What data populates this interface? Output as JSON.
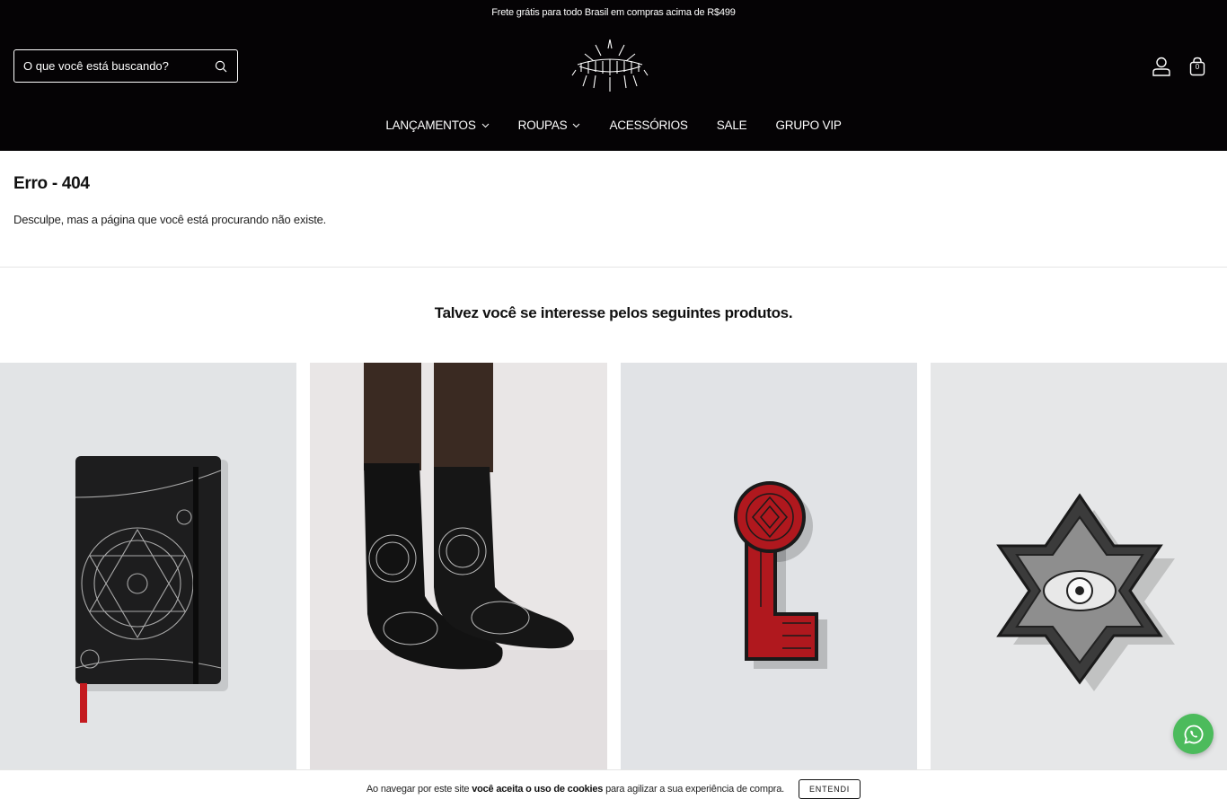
{
  "topbar": {
    "text": "Frete grátis para todo Brasil em compras acima de R$499"
  },
  "search": {
    "placeholder": "O que você está buscando?"
  },
  "header": {
    "cart_count": "0"
  },
  "nav": {
    "items": [
      {
        "label": "LANÇAMENTOS",
        "has_dropdown": true
      },
      {
        "label": "ROUPAS",
        "has_dropdown": true
      },
      {
        "label": "ACESSÓRIOS",
        "has_dropdown": false
      },
      {
        "label": "SALE",
        "has_dropdown": false
      },
      {
        "label": "GRUPO VIP",
        "has_dropdown": false
      }
    ]
  },
  "error": {
    "title": "Erro - 404",
    "message": "Desculpe, mas a página que você está procurando não existe."
  },
  "suggestions": {
    "title": "Talvez você se interesse pelos seguintes produtos."
  },
  "cookie": {
    "text_before": "Ao navegar por este site ",
    "text_bold": "você aceita o uso de cookies",
    "text_after": " para agilizar a sua experiência de compra.",
    "button": "ENTENDI"
  },
  "colors": {
    "header_bg": "#050305",
    "whatsapp": "#4cbb5c",
    "pin_red": "#b0181e"
  }
}
